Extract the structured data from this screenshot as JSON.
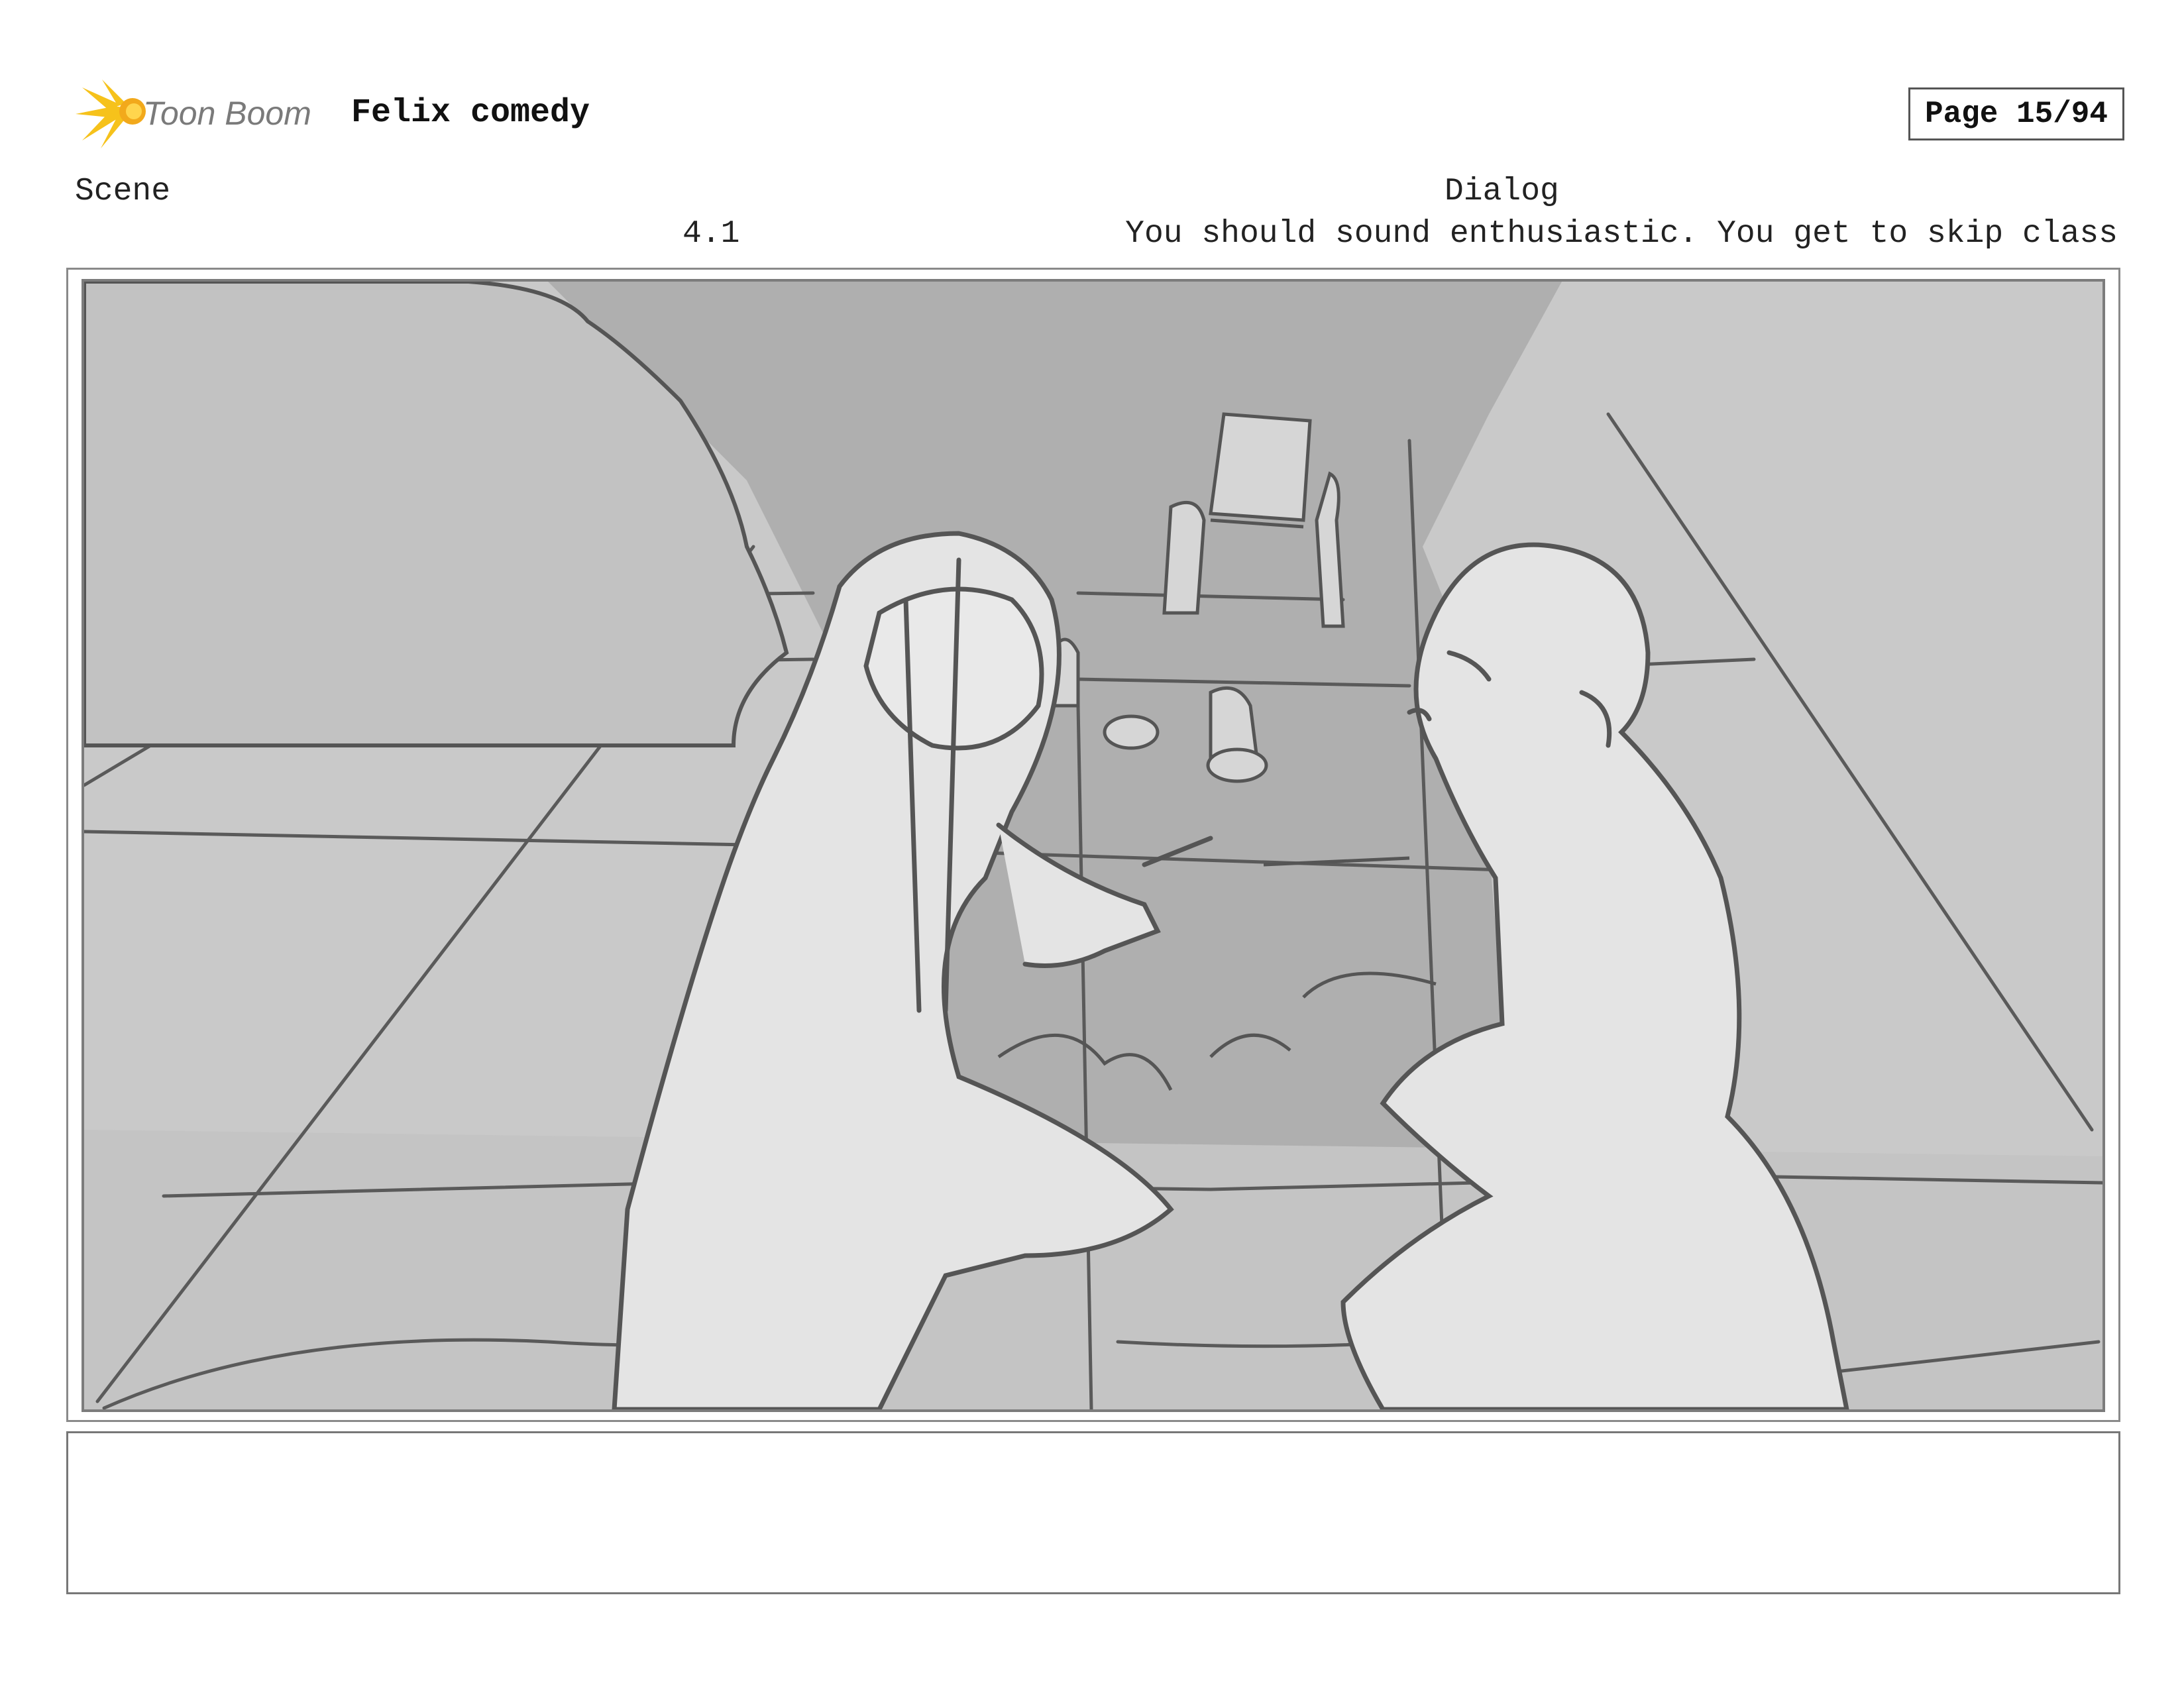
{
  "header": {
    "logo_text": "Toon Boom",
    "project_title": "Felix comedy",
    "page_label": "Page 15/94"
  },
  "columns": {
    "scene_label": "Scene",
    "dialog_label": "Dialog"
  },
  "panel": {
    "scene_number": "4.1",
    "dialog": "You should sound enthusiastic. You get to skip class"
  },
  "colors": {
    "logo_star": "#f6c21b",
    "logo_text": "#7a7a7a",
    "sketch_bg": "#c9c9c9",
    "sketch_dark": "#b0b0b0",
    "sketch_light": "#e3e3e3",
    "sketch_line": "#555555"
  },
  "icons": {
    "logo": "toon-boom-star-logo"
  }
}
